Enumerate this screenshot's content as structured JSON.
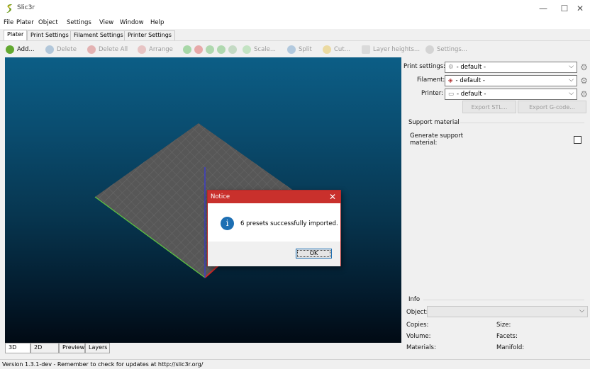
{
  "window": {
    "title": "Slic3r",
    "minimize": "—",
    "maximize": "☐",
    "close": "✕"
  },
  "menu": [
    "File",
    "Plater",
    "Object",
    "Settings",
    "View",
    "Window",
    "Help"
  ],
  "tabs": [
    "Plater",
    "Print Settings",
    "Filament Settings",
    "Printer Settings"
  ],
  "toolbar": {
    "add": "Add...",
    "delete": "Delete",
    "delete_all": "Delete All",
    "arrange": "Arrange",
    "scale": "Scale...",
    "split": "Split",
    "cut": "Cut...",
    "layer_heights": "Layer heights...",
    "settings": "Settings..."
  },
  "colors": {
    "dialog_title": "#c9302c",
    "info_icon": "#1d6fb3",
    "canvas_top": "#0c5e86",
    "canvas_bottom": "#010a14",
    "bed": "#5a5a5a",
    "axis_x": "#d02828",
    "axis_y": "#5cc240",
    "axis_z": "#3a3ad8"
  },
  "right_panel": {
    "print_settings_label": "Print settings:",
    "print_settings_value": "- default -",
    "filament_label": "Filament:",
    "filament_value": "- default -",
    "printer_label": "Printer:",
    "printer_value": "- default -",
    "export_stl": "Export STL...",
    "export_gcode": "Export G-code...",
    "support_section": "Support material",
    "generate_support": "Generate support material:",
    "info_section": "Info",
    "object_label": "Object:",
    "copies_label": "Copies:",
    "size_label": "Size:",
    "volume_label": "Volume:",
    "facets_label": "Facets:",
    "materials_label": "Materials:",
    "manifold_label": "Manifold:"
  },
  "view_tabs": [
    "3D",
    "2D",
    "Preview",
    "Layers"
  ],
  "status": "Version 1.3.1-dev - Remember to check for updates at http://slic3r.org/",
  "dialog": {
    "title": "Notice",
    "message": "6 presets successfully imported.",
    "ok": "OK",
    "icon": "i"
  }
}
